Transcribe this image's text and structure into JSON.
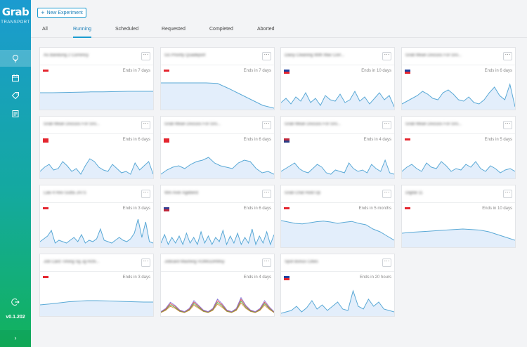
{
  "app": {
    "logo": "Grab",
    "sublabel": "TRANSPORT",
    "version": "v0.1.202",
    "expand_glyph": "›",
    "icons": [
      "lightbulb-icon",
      "calendar-icon",
      "tag-icon",
      "report-icon",
      "logout-icon"
    ]
  },
  "header": {
    "new_button_plus": "+",
    "new_button_label": "New Experiment"
  },
  "tabs": [
    {
      "label": "All",
      "active": false
    },
    {
      "label": "Running",
      "active": true
    },
    {
      "label": "Scheduled",
      "active": false
    },
    {
      "label": "Requested",
      "active": false
    },
    {
      "label": "Completed",
      "active": false
    },
    {
      "label": "Aborted",
      "active": false
    }
  ],
  "menu_glyph": "···",
  "colors": {
    "accent": "#1b9bd0",
    "spark_stroke": "#5aa9d6",
    "spark_fill": "#e3eefb"
  },
  "cards": [
    {
      "title": "Ao Bandung 2 Currency",
      "flag": "ID",
      "ends": "Ends in 7 days",
      "spark": [
        0.55,
        0.55,
        0.56,
        0.57,
        0.58,
        0.58,
        0.59,
        0.6,
        0.6,
        0.6
      ]
    },
    {
      "title": "Go Priority Quadeport",
      "flag": "ID",
      "ends": "Ends in 7 days",
      "spark": [
        0.9,
        0.9,
        0.9,
        0.9,
        0.9,
        0.88,
        0.7,
        0.5,
        0.3,
        0.1,
        0.0
      ]
    },
    {
      "title": "Daisy Cleaning With Max Corr...",
      "flag": "PH",
      "ends": "Ends in 10 days",
      "spark": [
        0.2,
        0.35,
        0.15,
        0.4,
        0.25,
        0.55,
        0.2,
        0.35,
        0.1,
        0.45,
        0.3,
        0.25,
        0.5,
        0.2,
        0.3,
        0.6,
        0.25,
        0.4,
        0.15,
        0.35,
        0.55,
        0.3,
        0.45,
        0.05
      ]
    },
    {
      "title": "Grab Mean Discuss For Gro...",
      "flag": "PH",
      "ends": "Ends in 6 days",
      "spark": [
        0.15,
        0.25,
        0.35,
        0.45,
        0.6,
        0.5,
        0.35,
        0.3,
        0.55,
        0.65,
        0.5,
        0.3,
        0.25,
        0.4,
        0.2,
        0.15,
        0.3,
        0.55,
        0.75,
        0.45,
        0.3,
        0.85,
        0.05
      ]
    },
    {
      "title": "Grab Mean Discuss For Gro...",
      "flag": "VN",
      "ends": "Ends in 6 days",
      "spark": [
        0.2,
        0.35,
        0.45,
        0.25,
        0.3,
        0.55,
        0.4,
        0.2,
        0.3,
        0.1,
        0.4,
        0.65,
        0.55,
        0.35,
        0.25,
        0.2,
        0.45,
        0.3,
        0.15,
        0.2,
        0.1,
        0.5,
        0.25,
        0.4,
        0.55,
        0.1
      ]
    },
    {
      "title": "Grab Mean Discuss For Gro...",
      "flag": "VN",
      "ends": "Ends in 6 days",
      "spark": [
        0.1,
        0.25,
        0.35,
        0.4,
        0.3,
        0.45,
        0.55,
        0.6,
        0.7,
        0.5,
        0.4,
        0.35,
        0.3,
        0.5,
        0.6,
        0.55,
        0.3,
        0.15,
        0.2,
        0.1
      ]
    },
    {
      "title": "Grab Mean Discuss For Gro...",
      "flag": "US",
      "ends": "Ends in 4 days",
      "spark": [
        0.2,
        0.3,
        0.4,
        0.5,
        0.3,
        0.2,
        0.15,
        0.3,
        0.45,
        0.35,
        0.15,
        0.1,
        0.25,
        0.2,
        0.15,
        0.5,
        0.3,
        0.2,
        0.25,
        0.15,
        0.45,
        0.3,
        0.2,
        0.6,
        0.15,
        0.1
      ]
    },
    {
      "title": "Grab Mean Discuss For Gro...",
      "flag": "SG",
      "ends": "Ends in 5 days",
      "spark": [
        0.2,
        0.35,
        0.45,
        0.3,
        0.2,
        0.5,
        0.35,
        0.3,
        0.55,
        0.4,
        0.2,
        0.3,
        0.25,
        0.45,
        0.35,
        0.55,
        0.3,
        0.2,
        0.4,
        0.3,
        0.15,
        0.25,
        0.3,
        0.2
      ]
    },
    {
      "title": "Law 4 Rev Gutta JATS",
      "flag": "ID",
      "ends": "Ends in 3 days",
      "spark": [
        0.15,
        0.25,
        0.35,
        0.55,
        0.1,
        0.2,
        0.15,
        0.1,
        0.2,
        0.3,
        0.15,
        0.4,
        0.1,
        0.2,
        0.15,
        0.25,
        0.6,
        0.2,
        0.15,
        0.1,
        0.2,
        0.3,
        0.2,
        0.15,
        0.25,
        0.45,
        0.95,
        0.3,
        0.85,
        0.15,
        0.1
      ]
    },
    {
      "title": "Win Aver Ageberd",
      "flag": "TH",
      "ends": "Ends in 6 days",
      "spark": [
        0.1,
        0.4,
        0.05,
        0.3,
        0.1,
        0.35,
        0.05,
        0.45,
        0.1,
        0.3,
        0.05,
        0.5,
        0.1,
        0.35,
        0.05,
        0.3,
        0.15,
        0.55,
        0.05,
        0.35,
        0.1,
        0.45,
        0.05,
        0.3,
        0.1,
        0.6,
        0.05,
        0.35,
        0.1,
        0.5,
        0.05,
        0.4
      ]
    },
    {
      "title": "Grab Chat Hold Up",
      "flag": "ID",
      "ends": "Ends in 5 months",
      "spark": [
        0.9,
        0.85,
        0.8,
        0.78,
        0.82,
        0.86,
        0.88,
        0.85,
        0.8,
        0.84,
        0.87,
        0.8,
        0.75,
        0.6,
        0.5,
        0.35,
        0.2
      ]
    },
    {
      "title": "Digital 11",
      "flag": "SG",
      "ends": "Ends in 10 days",
      "spark": [
        0.45,
        0.48,
        0.5,
        0.52,
        0.54,
        0.56,
        0.58,
        0.6,
        0.58,
        0.56,
        0.5,
        0.4,
        0.3,
        0.2
      ]
    },
    {
      "title": "Job Card Timing Sg Jg Rchi...",
      "flag": "SG",
      "ends": "Ends in 3 days",
      "spark": [
        0.35,
        0.38,
        0.42,
        0.46,
        0.48,
        0.5,
        0.5,
        0.49,
        0.48,
        0.47,
        0.46,
        0.45,
        0.45
      ]
    },
    {
      "title": "Jobcard Mashing VOMGDRMsy",
      "flag": "",
      "ends": "Ends in 4 days",
      "spark": [
        0.1,
        0.2,
        0.4,
        0.3,
        0.15,
        0.1,
        0.2,
        0.45,
        0.3,
        0.15,
        0.1,
        0.2,
        0.5,
        0.35,
        0.15,
        0.1,
        0.2,
        0.55,
        0.3,
        0.15,
        0.1,
        0.2,
        0.45,
        0.25,
        0.1
      ],
      "multi": true
    },
    {
      "title": "Spot Bonus Cities",
      "flag": "PH",
      "ends": "Ends in 20 hours",
      "spark": [
        0.05,
        0.1,
        0.15,
        0.3,
        0.1,
        0.25,
        0.5,
        0.2,
        0.35,
        0.15,
        0.3,
        0.45,
        0.2,
        0.15,
        0.85,
        0.3,
        0.2,
        0.55,
        0.3,
        0.45,
        0.2,
        0.15,
        0.1
      ]
    }
  ]
}
